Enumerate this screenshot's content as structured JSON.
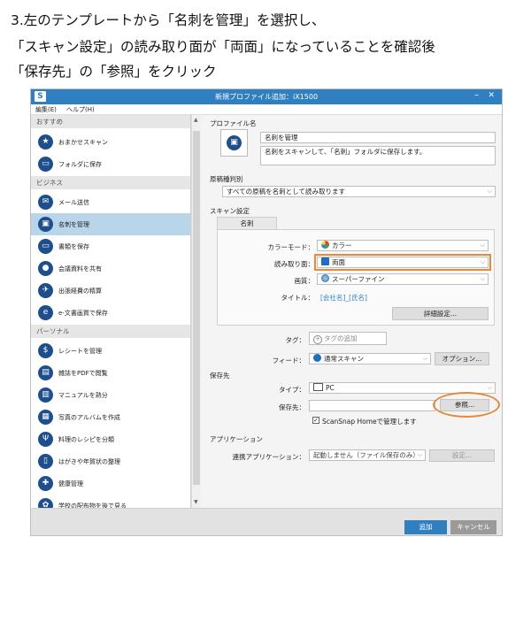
{
  "instructions": {
    "line1": "3.左のテンプレートから「名刺を管理」を選択し、",
    "line2": "「スキャン設定」の読み取り面が「両面」になっていることを確認後",
    "line3": "「保存先」の「参照」をクリック"
  },
  "window": {
    "logo": "S",
    "title": "新規プロファイル追加：iX1500",
    "minimize": "–",
    "close": "✕"
  },
  "menu": {
    "edit": "編集(E)",
    "help": "ヘルプ(H)"
  },
  "sidebar": {
    "sections": [
      {
        "label": "おすすめ"
      },
      {
        "label": "ビジネス"
      },
      {
        "label": "パーソナル"
      }
    ],
    "items": [
      {
        "label": "おまかせスキャン",
        "icon": "★"
      },
      {
        "label": "フォルダに保存",
        "icon": "▭"
      },
      {
        "label": "メール送信",
        "icon": "✉"
      },
      {
        "label": "名刺を管理",
        "icon": "▣"
      },
      {
        "label": "書類を保存",
        "icon": "▭"
      },
      {
        "label": "会議資料を共有",
        "icon": "●"
      },
      {
        "label": "出張経費の精算",
        "icon": "✈"
      },
      {
        "label": "e-文書画質で保存",
        "icon": "e"
      },
      {
        "label": "レシートを管理",
        "icon": "$"
      },
      {
        "label": "雑誌をPDFで閲覧",
        "icon": "▤"
      },
      {
        "label": "マニュアルを熟分",
        "icon": "▥"
      },
      {
        "label": "写真のアルバムを作成",
        "icon": "▦"
      },
      {
        "label": "料理のレシピを分類",
        "icon": "Ψ"
      },
      {
        "label": "はがきや年賀状の整理",
        "icon": "▯"
      },
      {
        "label": "健康管理",
        "icon": "✚"
      },
      {
        "label": "学校の配布物を後で見る",
        "icon": "✿"
      }
    ],
    "scroll_up": "▲",
    "scroll_down": "▼"
  },
  "profile": {
    "section_label": "プロファイル名",
    "name_value": "名刺を管理",
    "description_value": "名刺をスキャンして、「名刺」フォルダに保存します。"
  },
  "document_type": {
    "label": "原稿種判別",
    "value": "すべての原稿を名刺として読み取ります"
  },
  "scan_settings": {
    "label": "スキャン設定",
    "tab_label": "名刺",
    "color_mode_label": "カラーモード：",
    "color_mode_value": "カラー",
    "scan_side_label": "読み取り面：",
    "scan_side_value": "両面",
    "quality_label": "画質：",
    "quality_value": "スーパーファイン",
    "title_label": "タイトル：",
    "title_value": "[会社名]_[氏名]",
    "detail_button": "詳細設定..."
  },
  "tags": {
    "label": "タグ：",
    "placeholder": "タグの追加"
  },
  "feed": {
    "label": "フィード：",
    "value": "通常スキャン",
    "option_button": "オプション..."
  },
  "destination": {
    "section_label": "保存先",
    "type_label": "タイプ：",
    "type_value": "PC",
    "save_to_label": "保存先：",
    "save_to_value": "",
    "browse_button": "参照...",
    "manage_checkbox": "ScanSnap Homeで管理します",
    "manage_checked": true
  },
  "application": {
    "section_label": "アプリケーション",
    "linked_label": "連携アプリケーション：",
    "linked_value": "起動しません（ファイル保存のみ）",
    "settings_button": "設定..."
  },
  "footer": {
    "add_button": "追加",
    "cancel_button": "キャンセル"
  },
  "colors": {
    "accent": "#2f7fc1",
    "selected": "#b9d5ea",
    "highlight": "#e58a3a",
    "icon_bg": "#1f4e8c"
  }
}
